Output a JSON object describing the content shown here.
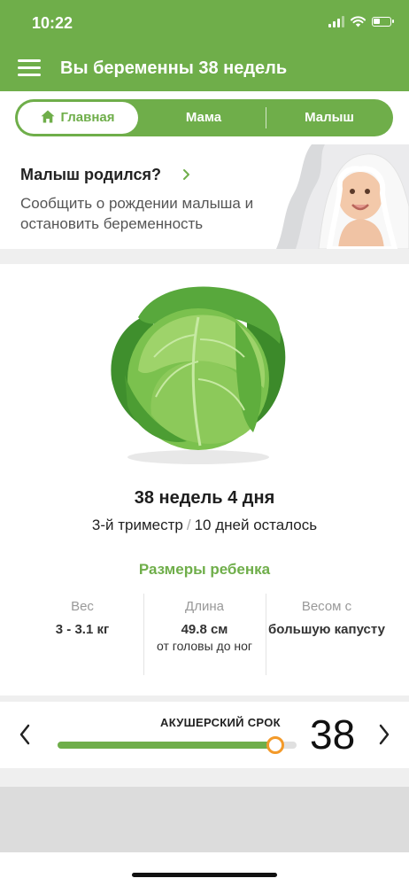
{
  "status_bar": {
    "time": "10:22"
  },
  "header": {
    "title": "Вы беременны 38 недель"
  },
  "tabs": [
    {
      "label": "Главная",
      "active": true
    },
    {
      "label": "Мама",
      "active": false
    },
    {
      "label": "Малыш",
      "active": false
    }
  ],
  "birth_card": {
    "title": "Малыш родился?",
    "text": "Сообщить о рождении малыша и остановить беременность"
  },
  "pregnancy": {
    "fruit_icon": "cabbage",
    "week_text": "38 недель 4 дня",
    "trimester": "3-й триместр",
    "days_left": "10 дней осталось",
    "sizes_title": "Размеры ребенка"
  },
  "stats": [
    {
      "label": "Вес",
      "value": "3 - 3.1 кг",
      "sub": ""
    },
    {
      "label": "Длина",
      "value": "49.8 см",
      "sub": "от головы до ног"
    },
    {
      "label": "Весом с",
      "value": "большую капусту",
      "sub": ""
    }
  ],
  "term_selector": {
    "label": "АКУШЕРСКИЙ СРОК",
    "week": "38",
    "progress_fraction": 0.91
  },
  "colors": {
    "accent": "#6fae4a",
    "slider_thumb": "#f39a2a"
  }
}
